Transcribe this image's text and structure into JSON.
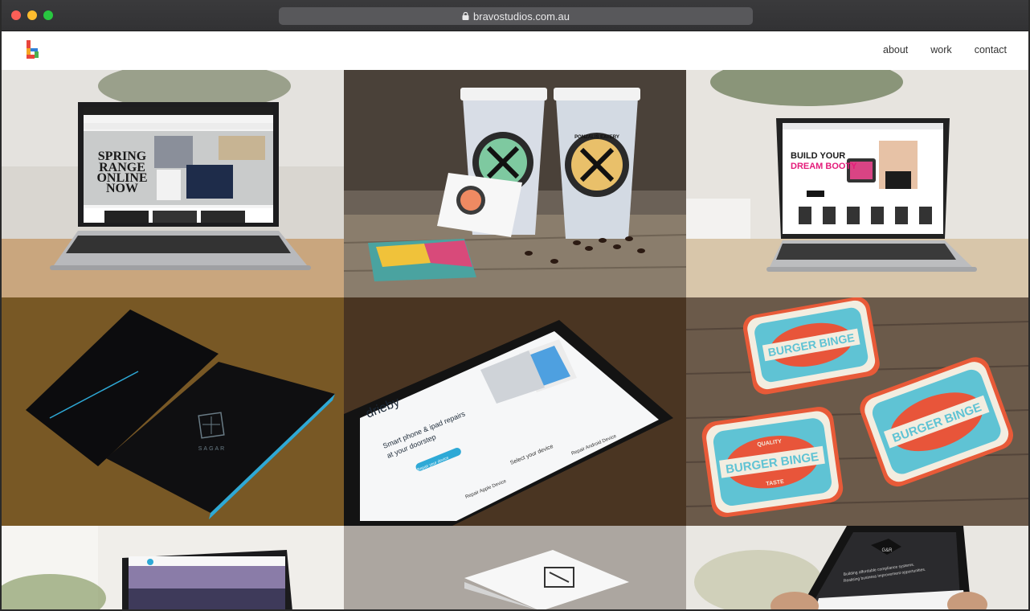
{
  "browser": {
    "url": "bravostudios.com.au"
  },
  "nav": {
    "items": [
      "about",
      "work",
      "contact"
    ]
  },
  "portfolio": {
    "tiles": [
      {
        "headline": [
          "SPRING",
          "RANGE",
          "ONLINE",
          "NOW"
        ]
      },
      {
        "brand": "PONZALIS EATERY"
      },
      {
        "headline": [
          "BUILD YOUR",
          "DREAM BOOTY"
        ]
      },
      {
        "brand": "SAGAR"
      },
      {
        "brand": "drieby",
        "headline": [
          "Smart phone & ipad repairs",
          "at your doorstep"
        ],
        "device_label": "Select your device",
        "button": "Repair your device",
        "apple_label": "Repair Apple Device",
        "android_label": "Repair Android Device"
      },
      {
        "brand": "BURGER BINGE",
        "sub_top": "QUALITY",
        "sub_bottom": "TASTE"
      },
      {},
      {},
      {
        "brand": "G&R",
        "headline": [
          "Building affordable compliance systems.",
          "Realising business improvement opportunities."
        ]
      }
    ]
  },
  "colors": {
    "accent_blue": "#2ea9d6",
    "burger_red": "#e8553a",
    "burger_teal": "#5fc3d4"
  }
}
